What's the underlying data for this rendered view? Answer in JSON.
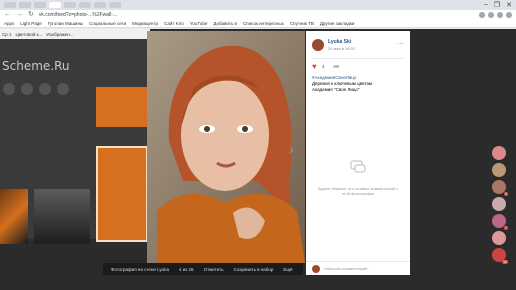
{
  "browser": {
    "url": "vk.com/feed?z=photo-...%2Fwall-...",
    "window_controls": [
      "–",
      "❐",
      "✕"
    ]
  },
  "bookmarks": [
    "Apps",
    "Light Page",
    "Гуголаи Машины",
    "Социальные сети",
    "Медиацентр",
    "Сайт Kiro",
    "YouTube",
    "Добавить в",
    "Список интересных",
    "Спутник ТВ",
    "Другие закладки"
  ],
  "left_panel": {
    "header": [
      "Ср 1",
      "Цветовой к...",
      "Изображен..."
    ],
    "logo": "Scheme.Ru"
  },
  "photo": {
    "caption": "Фотография на стене Lyuka",
    "counter": "4 из 26",
    "controls": [
      "Отметить",
      "Сохранить в набор",
      "Ещё"
    ]
  },
  "side_card": {
    "author": "Lyuka Ski",
    "date": "24 мая в 16:02",
    "like_count": "4",
    "hashtag": "#АкадемияСвоеЛицо",
    "lines": [
      "Деревня к ключевым цветам",
      "Академия \"Свое Лицо\""
    ],
    "empty_text": "Будьте первым, кто оставит комментарий к этой фотографии",
    "comment_placeholder": "Написать комментарий..."
  },
  "notifications": [
    {
      "badge": ""
    },
    {
      "badge": ""
    },
    {
      "badge": "4"
    },
    {
      "badge": ""
    },
    {
      "badge": "7"
    },
    {
      "badge": ""
    },
    {
      "badge": "12"
    }
  ],
  "colors": {
    "accent": "#d6701e",
    "vk_link": "#2a5885",
    "like": "#e64646"
  }
}
